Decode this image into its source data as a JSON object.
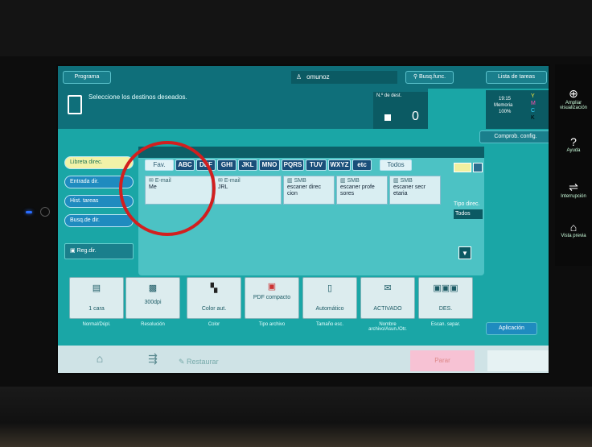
{
  "topbar": {
    "program": "Programa",
    "user": "omunoz",
    "search": "Busq.func.",
    "jobs": "Lista de tareas"
  },
  "message": "Seleccione los destinos deseados.",
  "counter": {
    "label": "N.º de dest.",
    "value": "0"
  },
  "status": {
    "time": "19:15",
    "memory": "Memoria",
    "memory_pct": "100%",
    "y": "Y",
    "m": "M",
    "c": "C",
    "k": "K"
  },
  "confirm_label": "Comprob. config.",
  "alpha_tabs": [
    "Fav.",
    "ABC",
    "DEF",
    "GHI",
    "JKL",
    "MNO",
    "PQRS",
    "TUV",
    "WXYZ",
    "etc",
    "Todos"
  ],
  "destinations": [
    {
      "type": "E-mail",
      "name": "Me"
    },
    {
      "type": "E-mail",
      "name": "JRL"
    },
    {
      "type": "SMB",
      "name": "escaner direc cion"
    },
    {
      "type": "SMB",
      "name": "escaner profe sores"
    },
    {
      "type": "SMB",
      "name": "escaner secr etaria"
    }
  ],
  "left_buttons": [
    "Libreta direc.",
    "Entrada dir.",
    "Hist. tareas",
    "Busq.de dir.",
    "Reg.dir."
  ],
  "dest_type": {
    "label": "Tipo direc.",
    "value": "Todos"
  },
  "functions": [
    {
      "value": "1 cara",
      "label": "Normal/Dúpl."
    },
    {
      "value": "300dpi",
      "label": "Resolución"
    },
    {
      "value": "Color aut.",
      "label": "Color"
    },
    {
      "value": "PDF compacto",
      "label": "Tipo archivo"
    },
    {
      "value": "Automático",
      "label": "Tamaño esc."
    },
    {
      "value": "ACTIVADO",
      "label": "Nombre archivo/Asun./Otr."
    },
    {
      "value": "DES.",
      "label": "Escan. separ."
    }
  ],
  "application": "Aplicación",
  "bottom": {
    "restore": "Restaurar",
    "stop": "Parar"
  },
  "right_strip": [
    {
      "icon": "⊕",
      "label": "Ampliar visualización"
    },
    {
      "icon": "?",
      "label": "Ayuda"
    },
    {
      "icon": "⇌",
      "label": "Interrupción"
    },
    {
      "icon": "⌂",
      "label": "Vista previa"
    }
  ]
}
